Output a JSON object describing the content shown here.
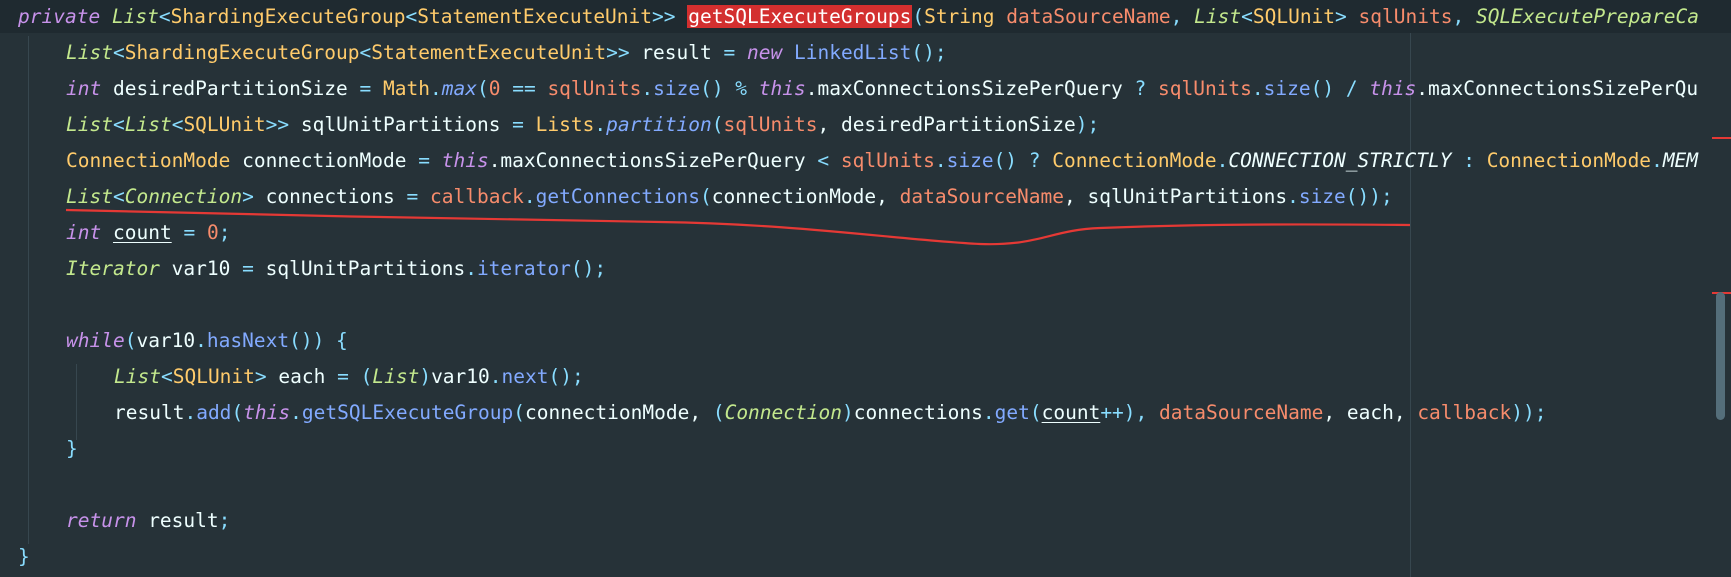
{
  "editor": {
    "theme_colors": {
      "background": "#263238",
      "keyword": "#c792ea",
      "type": "#ffcb6b",
      "method": "#82aaff",
      "parameter": "#f78c6c",
      "number": "#f78c6c",
      "search_highlight": "#d32f2f",
      "annotation_stroke": "#e53935"
    },
    "lines": [
      [
        {
          "t": "private",
          "c": "k"
        },
        {
          "t": " ",
          "c": "v"
        },
        {
          "t": "List",
          "c": "ti"
        },
        {
          "t": "<",
          "c": "p"
        },
        {
          "t": "ShardingExecuteGroup",
          "c": "t"
        },
        {
          "t": "<",
          "c": "p"
        },
        {
          "t": "StatementExecuteUnit",
          "c": "t"
        },
        {
          "t": ">>",
          "c": "p"
        },
        {
          "t": " ",
          "c": "v"
        },
        {
          "t": "getSQLExecuteGroups",
          "c": "hl"
        },
        {
          "t": "(",
          "c": "p"
        },
        {
          "t": "String",
          "c": "t"
        },
        {
          "t": " ",
          "c": "v"
        },
        {
          "t": "dataSourceName",
          "c": "pa"
        },
        {
          "t": ", ",
          "c": "p"
        },
        {
          "t": "List",
          "c": "ti"
        },
        {
          "t": "<",
          "c": "p"
        },
        {
          "t": "SQLUnit",
          "c": "t"
        },
        {
          "t": ">",
          "c": "p"
        },
        {
          "t": " ",
          "c": "v"
        },
        {
          "t": "sqlUnits",
          "c": "pa"
        },
        {
          "t": ", ",
          "c": "p"
        },
        {
          "t": "SQLExecutePrepareCa",
          "c": "ti"
        }
      ],
      [
        {
          "t": "List",
          "c": "ti"
        },
        {
          "t": "<",
          "c": "p"
        },
        {
          "t": "ShardingExecuteGroup",
          "c": "t"
        },
        {
          "t": "<",
          "c": "p"
        },
        {
          "t": "StatementExecuteUnit",
          "c": "t"
        },
        {
          "t": ">>",
          "c": "p"
        },
        {
          "t": " result ",
          "c": "v"
        },
        {
          "t": "=",
          "c": "p"
        },
        {
          "t": " ",
          "c": "v"
        },
        {
          "t": "new",
          "c": "k"
        },
        {
          "t": " ",
          "c": "v"
        },
        {
          "t": "LinkedList",
          "c": "m"
        },
        {
          "t": "();",
          "c": "p"
        }
      ],
      [
        {
          "t": "int",
          "c": "k"
        },
        {
          "t": " desiredPartitionSize ",
          "c": "v"
        },
        {
          "t": "=",
          "c": "p"
        },
        {
          "t": " ",
          "c": "v"
        },
        {
          "t": "Math",
          "c": "t"
        },
        {
          "t": ".",
          "c": "p"
        },
        {
          "t": "max",
          "c": "mi"
        },
        {
          "t": "(",
          "c": "p"
        },
        {
          "t": "0",
          "c": "n"
        },
        {
          "t": " == ",
          "c": "p"
        },
        {
          "t": "sqlUnits",
          "c": "pa"
        },
        {
          "t": ".",
          "c": "p"
        },
        {
          "t": "size",
          "c": "m"
        },
        {
          "t": "() % ",
          "c": "p"
        },
        {
          "t": "this",
          "c": "k"
        },
        {
          "t": ".maxConnectionsSizePerQuery ",
          "c": "v"
        },
        {
          "t": "?",
          "c": "p"
        },
        {
          "t": " ",
          "c": "v"
        },
        {
          "t": "sqlUnits",
          "c": "pa"
        },
        {
          "t": ".",
          "c": "p"
        },
        {
          "t": "size",
          "c": "m"
        },
        {
          "t": "() / ",
          "c": "p"
        },
        {
          "t": "this",
          "c": "k"
        },
        {
          "t": ".maxConnectionsSizePerQu",
          "c": "v"
        }
      ],
      [
        {
          "t": "List",
          "c": "ti"
        },
        {
          "t": "<",
          "c": "p"
        },
        {
          "t": "List",
          "c": "ti"
        },
        {
          "t": "<",
          "c": "p"
        },
        {
          "t": "SQLUnit",
          "c": "t"
        },
        {
          "t": ">>",
          "c": "p"
        },
        {
          "t": " sqlUnitPartitions ",
          "c": "v"
        },
        {
          "t": "=",
          "c": "p"
        },
        {
          "t": " ",
          "c": "v"
        },
        {
          "t": "Lists",
          "c": "t"
        },
        {
          "t": ".",
          "c": "p"
        },
        {
          "t": "partition",
          "c": "mi"
        },
        {
          "t": "(",
          "c": "p"
        },
        {
          "t": "sqlUnits",
          "c": "pa"
        },
        {
          "t": ", desiredPartitionSize",
          "c": "v"
        },
        {
          "t": ");",
          "c": "p"
        }
      ],
      [
        {
          "t": "ConnectionMode",
          "c": "t"
        },
        {
          "t": " connectionMode ",
          "c": "v"
        },
        {
          "t": "=",
          "c": "p"
        },
        {
          "t": " ",
          "c": "v"
        },
        {
          "t": "this",
          "c": "k"
        },
        {
          "t": ".maxConnectionsSizePerQuery ",
          "c": "v"
        },
        {
          "t": "<",
          "c": "p"
        },
        {
          "t": " ",
          "c": "v"
        },
        {
          "t": "sqlUnits",
          "c": "pa"
        },
        {
          "t": ".",
          "c": "p"
        },
        {
          "t": "size",
          "c": "m"
        },
        {
          "t": "() ? ",
          "c": "p"
        },
        {
          "t": "ConnectionMode",
          "c": "t"
        },
        {
          "t": ".",
          "c": "p"
        },
        {
          "t": "CONNECTION_STRICTLY",
          "c": "c"
        },
        {
          "t": " : ",
          "c": "p"
        },
        {
          "t": "ConnectionMode",
          "c": "t"
        },
        {
          "t": ".",
          "c": "p"
        },
        {
          "t": "MEM",
          "c": "c"
        }
      ],
      [
        {
          "t": "List",
          "c": "ti"
        },
        {
          "t": "<",
          "c": "p"
        },
        {
          "t": "Connection",
          "c": "ti"
        },
        {
          "t": ">",
          "c": "p"
        },
        {
          "t": " connections ",
          "c": "v"
        },
        {
          "t": "=",
          "c": "p"
        },
        {
          "t": " ",
          "c": "v"
        },
        {
          "t": "callback",
          "c": "pa"
        },
        {
          "t": ".",
          "c": "p"
        },
        {
          "t": "getConnections",
          "c": "m"
        },
        {
          "t": "(",
          "c": "p"
        },
        {
          "t": "connectionMode, ",
          "c": "v"
        },
        {
          "t": "dataSourceName",
          "c": "pa"
        },
        {
          "t": ", sqlUnitPartitions",
          "c": "v"
        },
        {
          "t": ".",
          "c": "p"
        },
        {
          "t": "size",
          "c": "m"
        },
        {
          "t": "());",
          "c": "p"
        }
      ],
      [
        {
          "t": "int",
          "c": "k"
        },
        {
          "t": " ",
          "c": "v"
        },
        {
          "t": "count",
          "c": "u"
        },
        {
          "t": " ",
          "c": "v"
        },
        {
          "t": "=",
          "c": "p"
        },
        {
          "t": " ",
          "c": "v"
        },
        {
          "t": "0",
          "c": "n"
        },
        {
          "t": ";",
          "c": "p"
        }
      ],
      [
        {
          "t": "Iterator",
          "c": "ti"
        },
        {
          "t": " var10 ",
          "c": "v"
        },
        {
          "t": "=",
          "c": "p"
        },
        {
          "t": " sqlUnitPartitions",
          "c": "v"
        },
        {
          "t": ".",
          "c": "p"
        },
        {
          "t": "iterator",
          "c": "m"
        },
        {
          "t": "();",
          "c": "p"
        }
      ],
      [],
      [
        {
          "t": "while",
          "c": "k"
        },
        {
          "t": "(",
          "c": "p"
        },
        {
          "t": "var10",
          "c": "v"
        },
        {
          "t": ".",
          "c": "p"
        },
        {
          "t": "hasNext",
          "c": "m"
        },
        {
          "t": "()) {",
          "c": "p"
        }
      ],
      [
        {
          "t": "List",
          "c": "ti"
        },
        {
          "t": "<",
          "c": "p"
        },
        {
          "t": "SQLUnit",
          "c": "t"
        },
        {
          "t": ">",
          "c": "p"
        },
        {
          "t": " each ",
          "c": "v"
        },
        {
          "t": "=",
          "c": "p"
        },
        {
          "t": " (",
          "c": "p"
        },
        {
          "t": "List",
          "c": "ti"
        },
        {
          "t": ")",
          "c": "p"
        },
        {
          "t": "var10",
          "c": "v"
        },
        {
          "t": ".",
          "c": "p"
        },
        {
          "t": "next",
          "c": "m"
        },
        {
          "t": "();",
          "c": "p"
        }
      ],
      [
        {
          "t": "result",
          "c": "v"
        },
        {
          "t": ".",
          "c": "p"
        },
        {
          "t": "add",
          "c": "m"
        },
        {
          "t": "(",
          "c": "p"
        },
        {
          "t": "this",
          "c": "k"
        },
        {
          "t": ".",
          "c": "p"
        },
        {
          "t": "getSQLExecuteGroup",
          "c": "m"
        },
        {
          "t": "(",
          "c": "p"
        },
        {
          "t": "connectionMode, ",
          "c": "v"
        },
        {
          "t": "(",
          "c": "p"
        },
        {
          "t": "Connection",
          "c": "ti"
        },
        {
          "t": ")",
          "c": "p"
        },
        {
          "t": "connections",
          "c": "v"
        },
        {
          "t": ".",
          "c": "p"
        },
        {
          "t": "get",
          "c": "m"
        },
        {
          "t": "(",
          "c": "p"
        },
        {
          "t": "count",
          "c": "u"
        },
        {
          "t": "++), ",
          "c": "p"
        },
        {
          "t": "dataSourceName",
          "c": "pa"
        },
        {
          "t": ", each, ",
          "c": "v"
        },
        {
          "t": "callback",
          "c": "pa"
        },
        {
          "t": "));",
          "c": "p"
        }
      ],
      [
        {
          "t": "}",
          "c": "p"
        }
      ],
      [],
      [
        {
          "t": "return",
          "c": "k"
        },
        {
          "t": " result",
          "c": "v"
        },
        {
          "t": ";",
          "c": "p"
        }
      ],
      [
        {
          "t": "}",
          "c": "p"
        }
      ]
    ]
  }
}
